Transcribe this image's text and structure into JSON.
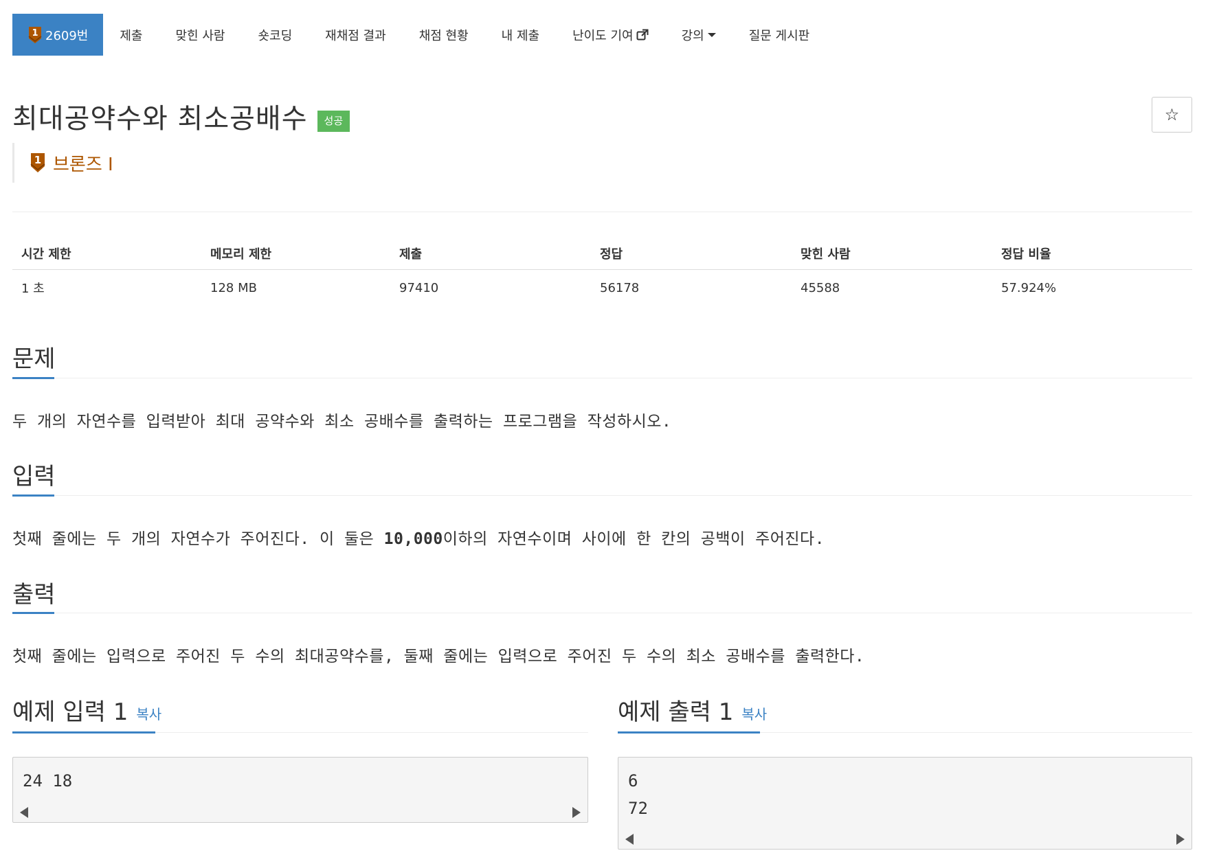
{
  "nav": {
    "problem_number": "2609번",
    "tier_digit": "1",
    "items": [
      "제출",
      "맞힌 사람",
      "숏코딩",
      "재채점 결과",
      "채점 현황",
      "내 제출",
      "난이도 기여",
      "강의",
      "질문 게시판"
    ]
  },
  "problem": {
    "title": "최대공약수와 최소공배수",
    "result_badge": "성공",
    "tier_label": "브론즈 I",
    "tier_digit": "1",
    "tier_color": "#ad5600",
    "star_label": "☆"
  },
  "stats": {
    "headers": [
      "시간 제한",
      "메모리 제한",
      "제출",
      "정답",
      "맞힌 사람",
      "정답 비율"
    ],
    "values": [
      "1 초",
      "128 MB",
      "97410",
      "56178",
      "45588",
      "57.924%"
    ]
  },
  "sections": {
    "description": {
      "heading": "문제",
      "text": "두 개의 자연수를 입력받아 최대 공약수와 최소 공배수를 출력하는 프로그램을 작성하시오."
    },
    "input": {
      "heading": "입력",
      "text_before": "첫째 줄에는 두 개의 자연수가 주어진다. 이 둘은 ",
      "text_bold": "10,000",
      "text_after": "이하의 자연수이며 사이에 한 칸의 공백이 주어진다."
    },
    "output": {
      "heading": "출력",
      "text": "첫째 줄에는 입력으로 주어진 두 수의 최대공약수를, 둘째 줄에는 입력으로 주어진 두 수의 최소 공배수를 출력한다."
    }
  },
  "samples": {
    "input": {
      "heading": "예제 입력 1",
      "copy": "복사",
      "content": "24 18"
    },
    "output": {
      "heading": "예제 출력 1",
      "copy": "복사",
      "content": "6\n72"
    }
  },
  "colors": {
    "accent": "#3b82c4",
    "success": "#5cb85c",
    "bronze": "#ad5600"
  }
}
